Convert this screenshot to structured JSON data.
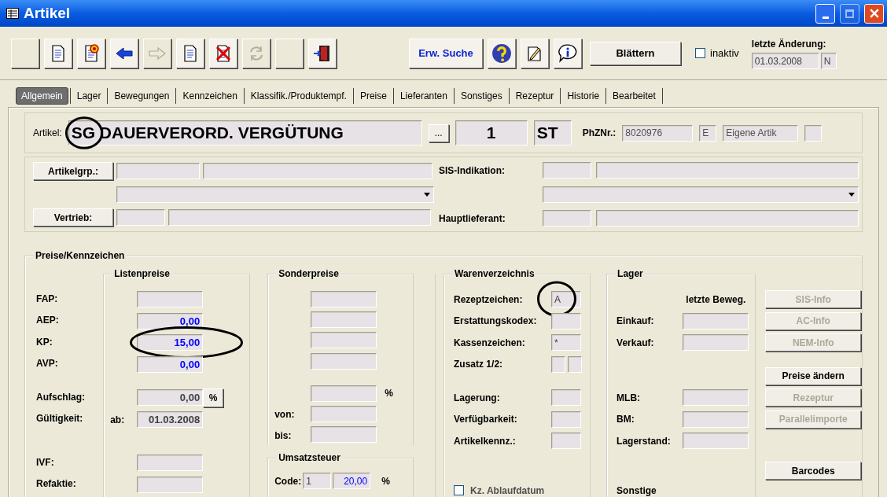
{
  "window": {
    "title": "Artikel"
  },
  "toolbar": {
    "buttons": [
      {
        "kind": "blank",
        "disabled": true
      },
      {
        "kind": "document",
        "disabled": false
      },
      {
        "kind": "badge",
        "disabled": false
      },
      {
        "kind": "back",
        "disabled": false
      },
      {
        "kind": "forward",
        "disabled": true
      },
      {
        "kind": "document",
        "disabled": false
      },
      {
        "kind": "delete",
        "disabled": false
      },
      {
        "kind": "refresh",
        "disabled": true
      },
      {
        "kind": "blank",
        "disabled": true
      },
      {
        "kind": "exit",
        "disabled": false
      }
    ],
    "search_button": "Erw. Suche",
    "tools": [
      {
        "kind": "help"
      },
      {
        "kind": "edit"
      },
      {
        "kind": "info"
      }
    ],
    "browse_button": "Blättern",
    "inactive": {
      "label": "inaktiv",
      "checked": false
    },
    "last_change": {
      "label": "letzte Änderung:",
      "date": "01.03.2008",
      "flag": "N"
    }
  },
  "tabs": [
    {
      "label": "Allgemein",
      "selected": true
    },
    {
      "label": "Lager",
      "selected": false
    },
    {
      "label": "Bewegungen",
      "selected": false
    },
    {
      "label": "Kennzeichen",
      "selected": false
    },
    {
      "label": "Klassifik./Produktempf.",
      "selected": false
    },
    {
      "label": "Preise",
      "selected": false
    },
    {
      "label": "Lieferanten",
      "selected": false
    },
    {
      "label": "Sonstiges",
      "selected": false
    },
    {
      "label": "Rezeptur",
      "selected": false
    },
    {
      "label": "Historie",
      "selected": false
    },
    {
      "label": "Bearbeitet",
      "selected": false
    }
  ],
  "article": {
    "label": "Artikel:",
    "name": "SG DAUERVERORD. VERGÜTUNG",
    "more_button": "...",
    "quantity": "1",
    "unit": "ST",
    "pzn_label": "PhZNr.:",
    "pzn": "8020976",
    "pzn_flag": "E",
    "origin": "Eigene Artik"
  },
  "classification": {
    "group_button": "Artikelgrp.:",
    "sales_button": "Vertrieb:",
    "sis_label": "SIS-Indikation:",
    "supplier_label": "Hauptlieferant:"
  },
  "prices": {
    "title": "Preise/Kennzeichen",
    "list_prices": {
      "title": "Listenpreise",
      "rows": [
        {
          "label": "FAP:"
        },
        {
          "label": "AEP:",
          "value": "0,00",
          "color": "#0000ff"
        },
        {
          "label": "KP:",
          "value": "15,00",
          "color": "#0000ff"
        },
        {
          "label": "AVP:",
          "value": "0,00",
          "color": "#0000ff"
        },
        {
          "label": "Aufschlag:",
          "value": "0,00",
          "color": "#404040",
          "unit_button": "%"
        },
        {
          "label": "Gültigkeit:",
          "prefix": "ab:",
          "value": "01.03.2008",
          "color": "#404040"
        },
        {
          "label": "IVF:"
        },
        {
          "label": "Refaktie:"
        }
      ]
    },
    "special_prices": {
      "title": "Sonderpreise",
      "rows": [
        {},
        {},
        {},
        {},
        {
          "suffix": "%"
        },
        {
          "prefix": "von:"
        },
        {
          "prefix": "bis:"
        }
      ]
    },
    "vat": {
      "title": "Umsatzsteuer",
      "code_label": "Code:",
      "code": "1",
      "rate": "20,00",
      "unit": "%"
    },
    "goods": {
      "title": "Warenverzeichnis",
      "rows": [
        {
          "kind": "field",
          "label": "Rezeptzeichen:",
          "value": "A"
        },
        {
          "kind": "field",
          "label": "Erstattungskodex:"
        },
        {
          "kind": "field",
          "label": "Kassenzeichen:",
          "value": "*"
        },
        {
          "kind": "pair",
          "label": "Zusatz 1/2:"
        },
        {
          "kind": "field",
          "label": "Lagerung:"
        },
        {
          "kind": "field",
          "label": "Verfügbarkeit:"
        },
        {
          "kind": "field",
          "label": "Artikelkennz.:"
        }
      ],
      "expiry": {
        "label": "Kz. Ablaufdatum",
        "checked": false
      }
    },
    "stock": {
      "title": "Lager",
      "column_heading": "letzte Beweg.",
      "rows": [
        {
          "label": "Einkauf:"
        },
        {
          "label": "Verkauf:"
        },
        {
          "label": "MLB:"
        },
        {
          "label": "BM:"
        },
        {
          "label": "Lagerstand:"
        }
      ],
      "other": "Sonstige"
    },
    "buttons": [
      {
        "label": "SIS-Info",
        "disabled": true
      },
      {
        "label": "AC-Info",
        "disabled": true
      },
      {
        "label": "NEM-Info",
        "disabled": true
      },
      {
        "label": "Preise ändern",
        "disabled": false
      },
      {
        "label": "Rezeptur",
        "disabled": true
      },
      {
        "label": "Parallelimporte",
        "disabled": true
      }
    ],
    "bottom_button": {
      "label": "Barcodes",
      "disabled": false
    }
  }
}
